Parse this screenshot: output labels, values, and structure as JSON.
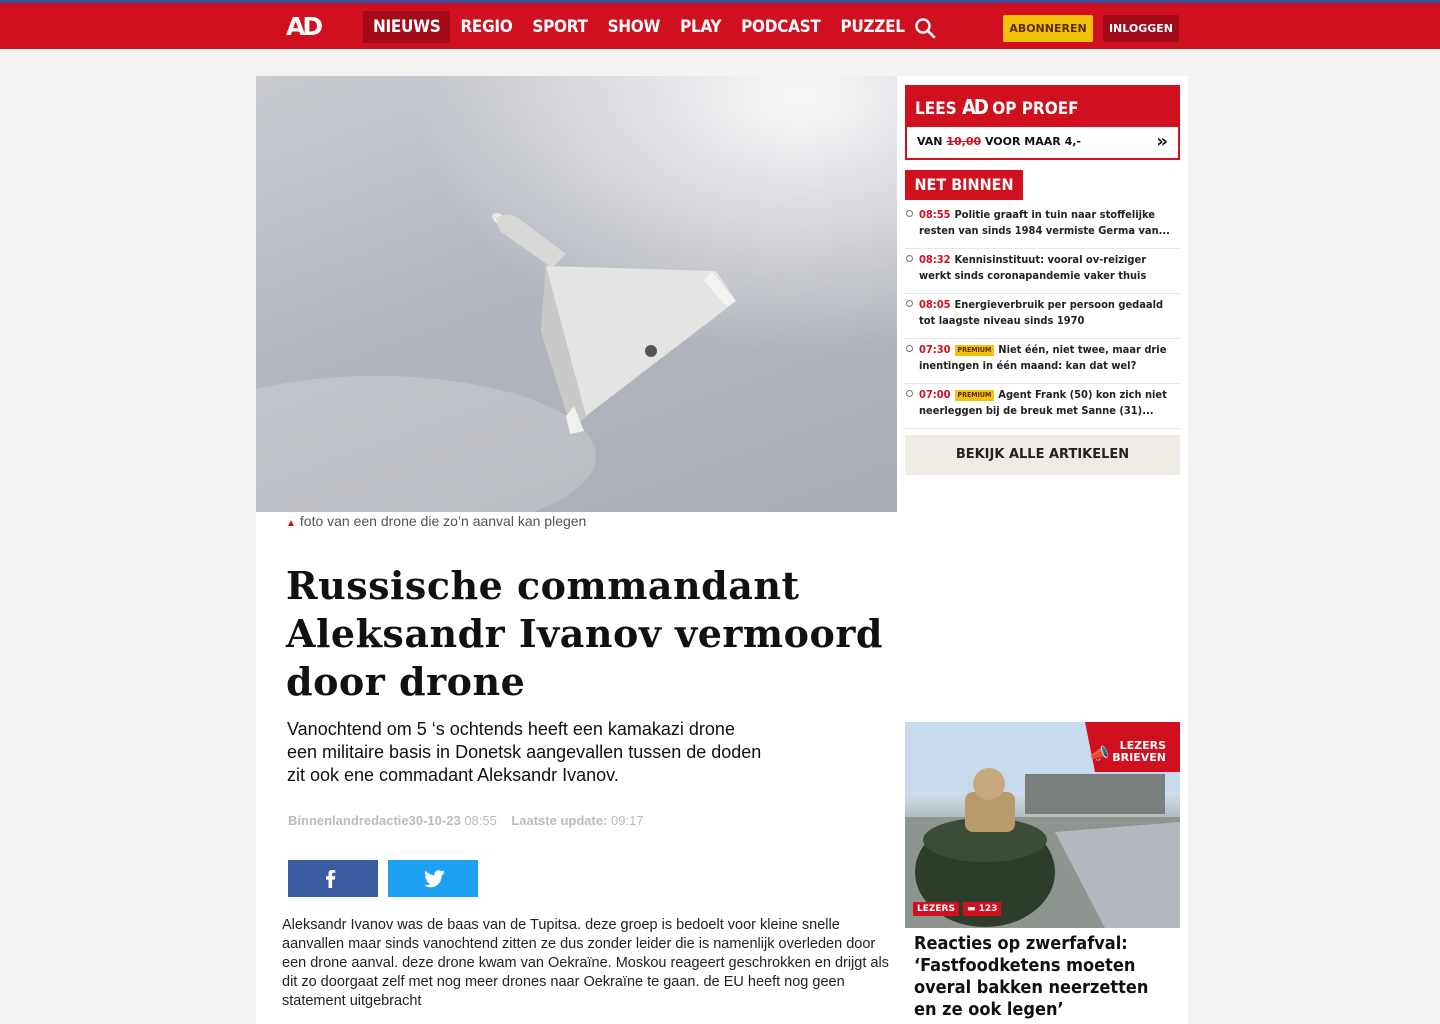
{
  "header": {
    "logo_text": "AD",
    "nav": [
      "NIEUWS",
      "REGIO",
      "SPORT",
      "SHOW",
      "PLAY",
      "PODCAST",
      "PUZZEL"
    ],
    "active_nav": "NIEUWS",
    "subscribe_label": "ABONNEREN",
    "login_label": "INLOGGEN"
  },
  "hero": {
    "caption": "foto van een drone die zo’n aanval kan plegen"
  },
  "article": {
    "title": "Russische commandant Aleksandr Ivanov vermoord door drone",
    "lead": "Vanochtend om 5 ‘s ochtends heeft een kamakazi drone een militaire basis in Donetsk aangevallen tussen de doden zit ook ene commadant Aleksandr Ivanov.",
    "author": "Binnenlandredactie",
    "date": "30-10-23",
    "time": "08:55",
    "update_label": "Laatste update:",
    "update_time": "09:17",
    "body": "Aleksandr Ivanov was de baas van de Tupitsa. deze groep is bedoelt voor kleine snelle aanvallen maar sinds vanochtend zitten ze dus zonder leider die is namenlijk overleden door een drone aanval. deze drone kwam van Oekraïne. Moskou reageert geschrokken en drijgt als dit zo doorgaat zelf met nog meer drones naar Oekraïne te gaan. de EU heeft nog geen statement uitgebracht"
  },
  "sidebar": {
    "promo": {
      "lees": "LEES",
      "logo": "AD",
      "op_proef": "OP PROEF",
      "van": "VAN",
      "old_price": "10,00",
      "new_price": "VOOR MAAR 4,-",
      "arrow": "»"
    },
    "net_binnen_label": "NET BINNEN",
    "premium_label": "PREMIUM",
    "news": [
      {
        "time": "08:55",
        "premium": false,
        "title": "Politie graaft in tuin naar stoffelijke resten van sinds 1984 vermiste Germa van..."
      },
      {
        "time": "08:32",
        "premium": false,
        "title": "Kennisinstituut: vooral ov-reiziger werkt sinds coronapandemie vaker thuis"
      },
      {
        "time": "08:05",
        "premium": false,
        "title": "Energieverbruik per persoon gedaald tot laagste niveau sinds 1970"
      },
      {
        "time": "07:30",
        "premium": true,
        "title": "Niet één, niet twee, maar drie inentingen in één maand: kan dat wel?"
      },
      {
        "time": "07:00",
        "premium": true,
        "title": "Agent Frank (50) kon zich niet neerleggen bij de breuk met Sanne (31)..."
      }
    ],
    "all_articles_label": "BEKIJK ALLE ARTIKELEN",
    "card": {
      "badge": "LEZERS BRIEVEN",
      "lezers_tag": "LEZERS",
      "comments": "123",
      "title": "Reacties op zwerfafval: ‘Fastfoodketens moeten overal bakken neerzetten en ze ook legen’"
    }
  },
  "colors": {
    "brand_red": "#d0101f",
    "dark_red": "#a30b18",
    "premium_yellow": "#f4c20d",
    "facebook": "#3a5ba0",
    "twitter": "#1da1f2"
  }
}
